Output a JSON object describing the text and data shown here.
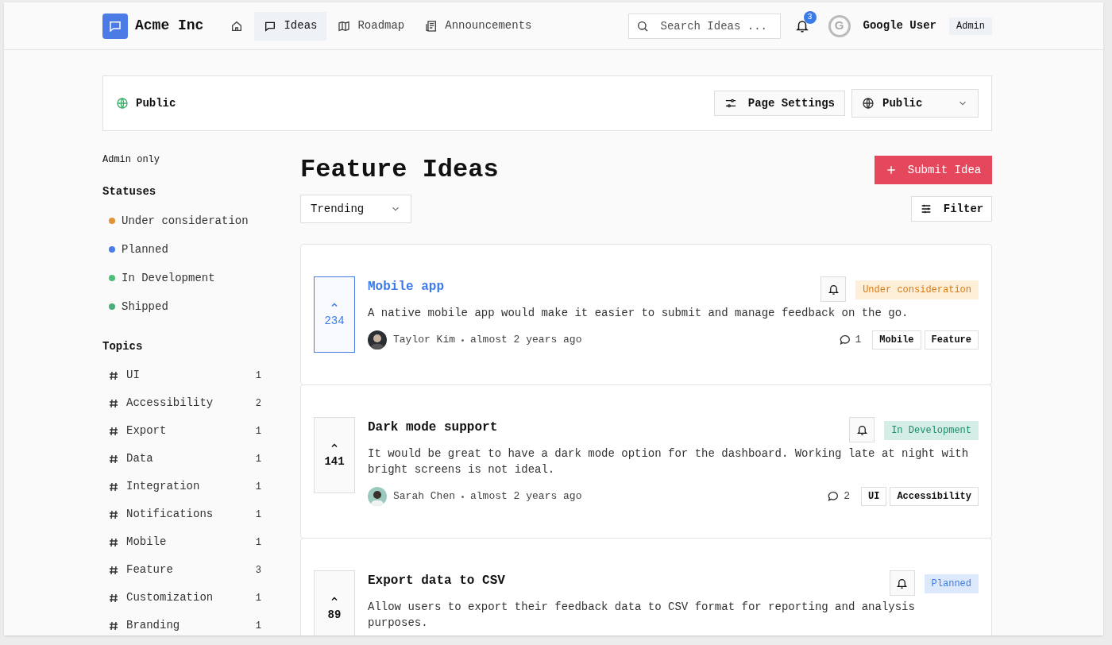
{
  "header": {
    "brand": "Acme Inc",
    "nav": [
      {
        "kind": "home",
        "selected": false
      },
      {
        "kind": "ideas",
        "label": "Ideas",
        "selected": true
      },
      {
        "kind": "roadmap",
        "label": "Roadmap",
        "selected": false
      },
      {
        "kind": "announcements",
        "label": "Announcements",
        "selected": false
      }
    ],
    "search": {
      "placeholder": "Search Ideas ..."
    },
    "notification_count": "3",
    "user": {
      "avatar_letter": "G",
      "name": "Google User",
      "role": "Admin"
    }
  },
  "visibility_bar": {
    "label": "Public",
    "settings_button": "Page Settings",
    "visibility_select": "Public"
  },
  "sidebar": {
    "note": "Admin only",
    "statuses_heading": "Statuses",
    "statuses": [
      {
        "label": "Under consideration",
        "color": "#e0943a"
      },
      {
        "label": "Planned",
        "color": "#4a7de8"
      },
      {
        "label": "In Development",
        "color": "#4cbf7a"
      },
      {
        "label": "Shipped",
        "color": "#4cae78"
      }
    ],
    "topics_heading": "Topics",
    "topics": [
      {
        "label": "UI",
        "count": "1"
      },
      {
        "label": "Accessibility",
        "count": "2"
      },
      {
        "label": "Export",
        "count": "1"
      },
      {
        "label": "Data",
        "count": "1"
      },
      {
        "label": "Integration",
        "count": "1"
      },
      {
        "label": "Notifications",
        "count": "1"
      },
      {
        "label": "Mobile",
        "count": "1"
      },
      {
        "label": "Feature",
        "count": "3"
      },
      {
        "label": "Customization",
        "count": "1"
      },
      {
        "label": "Branding",
        "count": "1"
      }
    ]
  },
  "main": {
    "title": "Feature Ideas",
    "submit_button": "Submit Idea",
    "sort_select": "Trending",
    "filter_button": "Filter",
    "ideas": [
      {
        "title": "Mobile app",
        "voted": true,
        "votes": "234",
        "status": {
          "kind": "consideration",
          "label": "Under consideration"
        },
        "description": "A native mobile app would make it easier to submit and manage feedback on the go.",
        "author": "Taylor Kim",
        "time": "almost 2 years ago",
        "comments": "1",
        "tags": [
          "Mobile",
          "Feature"
        ]
      },
      {
        "title": "Dark mode support",
        "voted": false,
        "votes": "141",
        "status": {
          "kind": "development",
          "label": "In Development"
        },
        "description": "It would be great to have a dark mode option for the dashboard. Working late at night with bright screens is not ideal.",
        "author": "Sarah Chen",
        "time": "almost 2 years ago",
        "comments": "2",
        "tags": [
          "UI",
          "Accessibility"
        ]
      },
      {
        "title": "Export data to CSV",
        "voted": false,
        "votes": "89",
        "status": {
          "kind": "planned",
          "label": "Planned"
        },
        "description": "Allow users to export their feedback data to CSV format for reporting and analysis purposes."
      }
    ]
  }
}
